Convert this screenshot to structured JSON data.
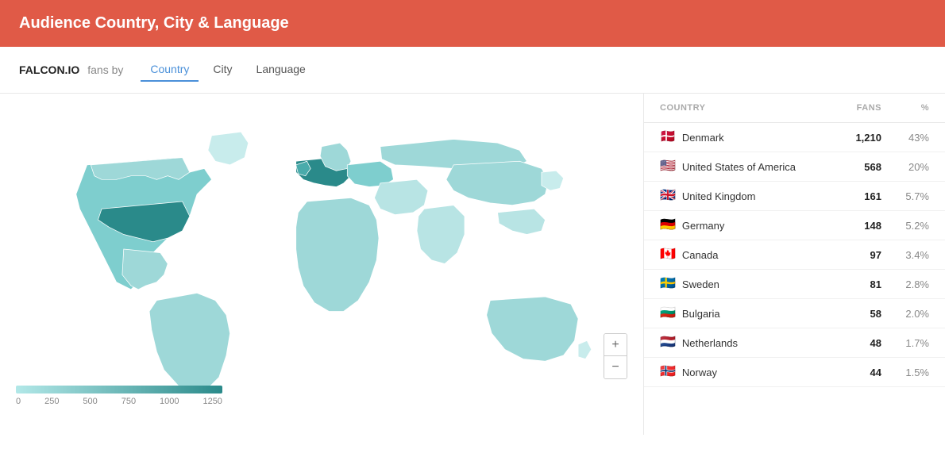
{
  "header": {
    "title": "Audience Country, City & Language"
  },
  "tabs_bar": {
    "brand": "FALCON.IO",
    "fans_by": "fans by",
    "tabs": [
      {
        "id": "country",
        "label": "Country",
        "active": true
      },
      {
        "id": "city",
        "label": "City",
        "active": false
      },
      {
        "id": "language",
        "label": "Language",
        "active": false
      }
    ]
  },
  "legend": {
    "values": [
      "0",
      "250",
      "500",
      "750",
      "1000",
      "1250"
    ]
  },
  "zoom": {
    "plus": "+",
    "minus": "−"
  },
  "table": {
    "columns": {
      "country": "COUNTRY",
      "fans": "FANS",
      "pct": "%"
    },
    "rows": [
      {
        "flag": "🇩🇰",
        "country": "Denmark",
        "fans": "1,210",
        "pct": "43%"
      },
      {
        "flag": "🇺🇸",
        "country": "United States of America",
        "fans": "568",
        "pct": "20%"
      },
      {
        "flag": "🇬🇧",
        "country": "United Kingdom",
        "fans": "161",
        "pct": "5.7%"
      },
      {
        "flag": "🇩🇪",
        "country": "Germany",
        "fans": "148",
        "pct": "5.2%"
      },
      {
        "flag": "🇨🇦",
        "country": "Canada",
        "fans": "97",
        "pct": "3.4%"
      },
      {
        "flag": "🇸🇪",
        "country": "Sweden",
        "fans": "81",
        "pct": "2.8%"
      },
      {
        "flag": "🇧🇬",
        "country": "Bulgaria",
        "fans": "58",
        "pct": "2.0%"
      },
      {
        "flag": "🇳🇱",
        "country": "Netherlands",
        "fans": "48",
        "pct": "1.7%"
      },
      {
        "flag": "🇳🇴",
        "country": "Norway",
        "fans": "44",
        "pct": "1.5%"
      }
    ]
  },
  "colors": {
    "header_bg": "#e05a47",
    "active_tab": "#4a90d9",
    "map_dark": "#2a8a8a",
    "map_light": "#b2e0e0"
  }
}
